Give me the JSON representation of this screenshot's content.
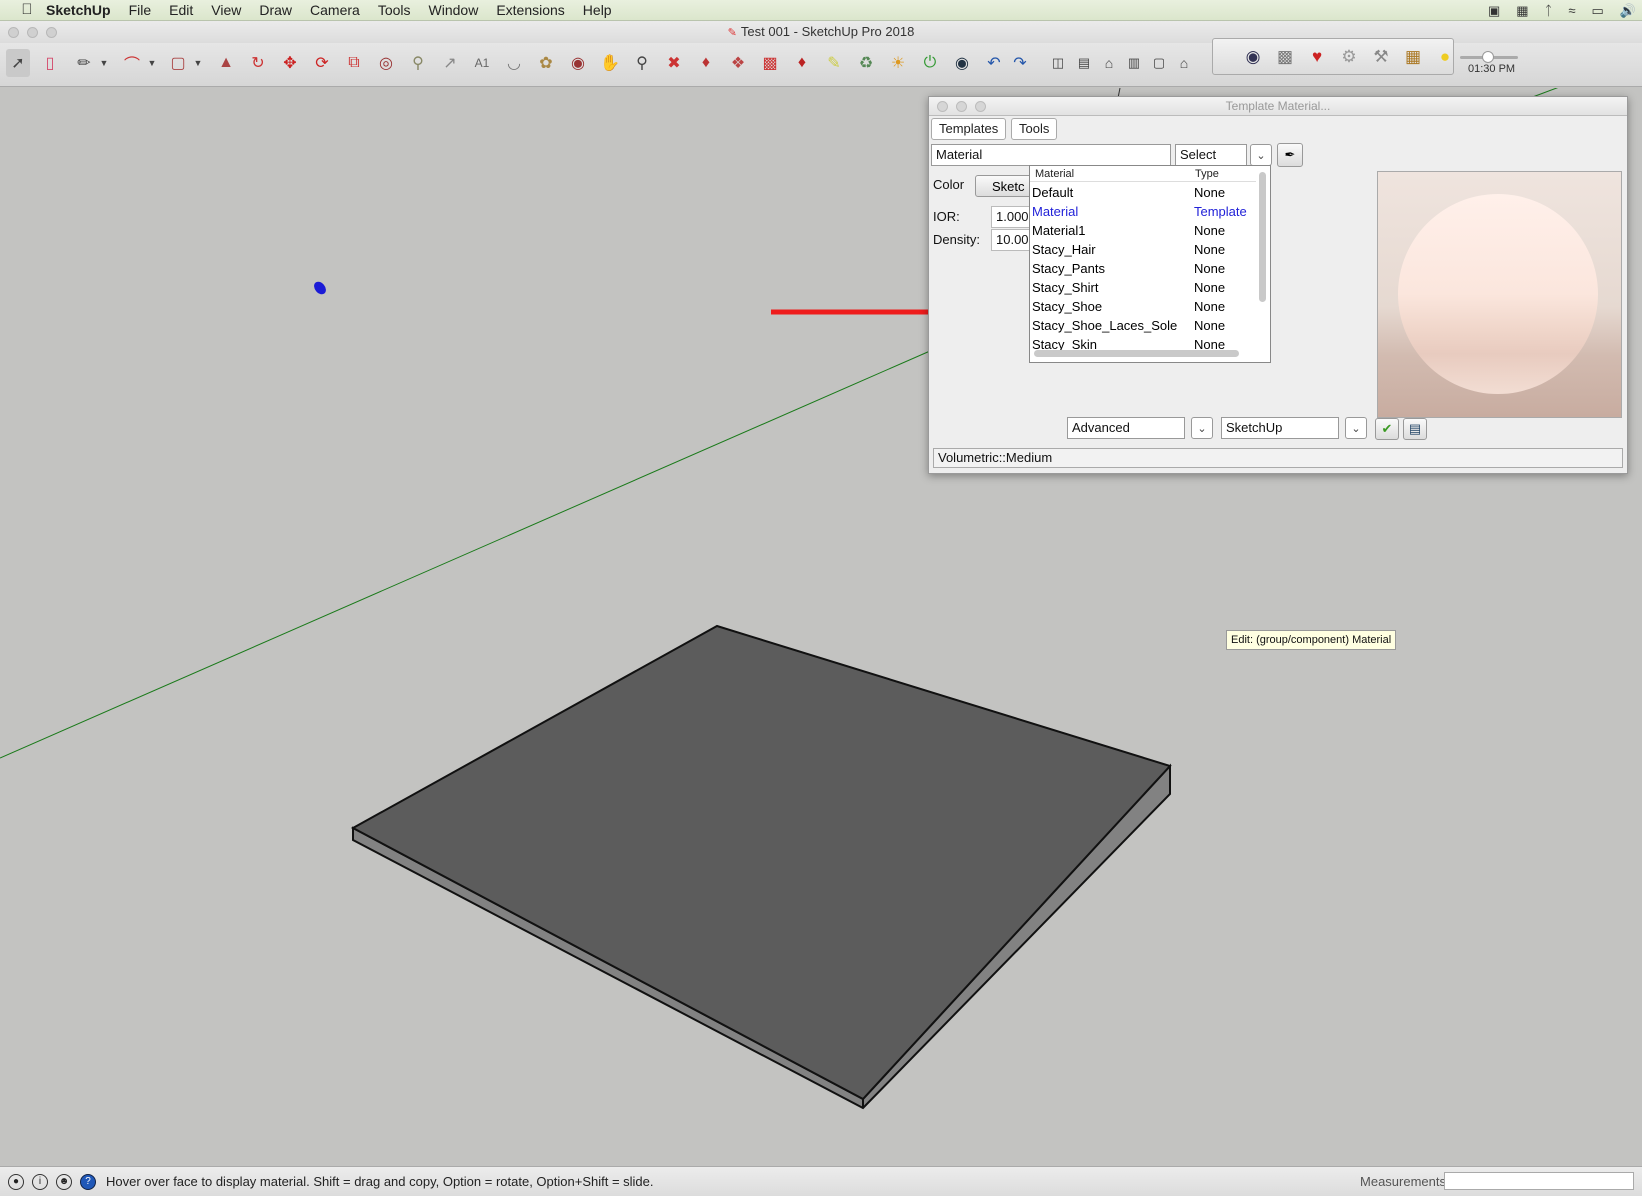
{
  "menubar": {
    "app_name": "SketchUp",
    "items": [
      "File",
      "Edit",
      "View",
      "Draw",
      "Camera",
      "Tools",
      "Window",
      "Extensions",
      "Help"
    ]
  },
  "window": {
    "title": "Test 001 - SketchUp Pro 2018"
  },
  "toolbar": {
    "time_label": "01:30 PM"
  },
  "panel": {
    "title": "Template Material...",
    "tabs": [
      "Templates",
      "Tools"
    ],
    "material_field": "Material",
    "select_value": "Select",
    "color_label": "Color",
    "color_button": "Sketc",
    "ior_label": "IOR:",
    "ior_value": "1.000",
    "density_label": "Density:",
    "density_value": "10.00",
    "list": {
      "col_material": "Material",
      "col_type": "Type",
      "rows": [
        {
          "name": "Default",
          "type": "None"
        },
        {
          "name": "Material",
          "type": "Template"
        },
        {
          "name": "Material1",
          "type": "None"
        },
        {
          "name": "Stacy_Hair",
          "type": "None"
        },
        {
          "name": "Stacy_Pants",
          "type": "None"
        },
        {
          "name": "Stacy_Shirt",
          "type": "None"
        },
        {
          "name": "Stacy_Shoe",
          "type": "None"
        },
        {
          "name": "Stacy_Shoe_Laces_Sole",
          "type": "None"
        },
        {
          "name": "Stacy_Skin",
          "type": "None"
        }
      ]
    },
    "mode_select": "Advanced",
    "engine_select": "SketchUp",
    "status": "Volumetric::Medium"
  },
  "tooltip": "Edit: (group/component) Material",
  "statusbar": {
    "hint": "Hover over face to display material. Shift = drag and copy, Option = rotate, Option+Shift = slide.",
    "measurements_label": "Measurements"
  },
  "colors": {
    "viewport_bg": "#c3c3c1",
    "box_top": "#5c5c5c",
    "box_side": "#828282",
    "arrow": "#ee1c1c",
    "active_row": "#2222d8"
  }
}
